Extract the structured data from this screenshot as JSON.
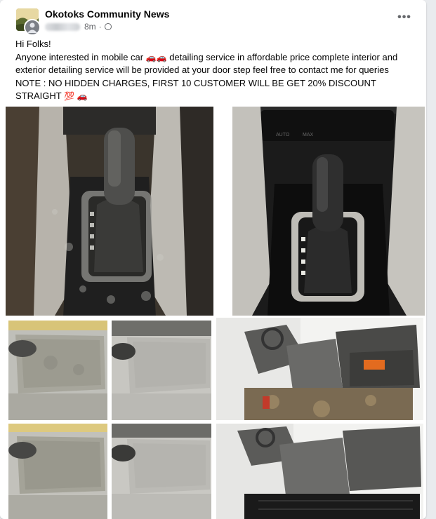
{
  "post": {
    "group_name": "Okotoks Community News",
    "time": "8m",
    "separator": "·",
    "more_label": "•••",
    "greeting": "Hi Folks!",
    "line1_pre": "Anyone interested in mobile car",
    "car_emoji": "🚗🚗",
    "line1_post": "detailing service in affordable price complete interior and exterior detailing service will be provided at your door step feel free to contact me for queries",
    "note": "NOTE : NO HIDDEN CHARGES, FIRST 10 CUSTOMER WILL BE GET 20% DISCOUNT STRAIGHT",
    "hundred_emoji": "💯",
    "end_emoji": "🚗",
    "dash_buttons": [
      "AUTO",
      "MAX",
      "",
      "",
      "",
      ""
    ]
  },
  "colors": {
    "accent": "#1877f2",
    "text": "#050505",
    "muted": "#65676b"
  },
  "icons": [
    "globe-icon",
    "more-options-icon",
    "car-emoji-icon",
    "hundred-points-icon"
  ]
}
